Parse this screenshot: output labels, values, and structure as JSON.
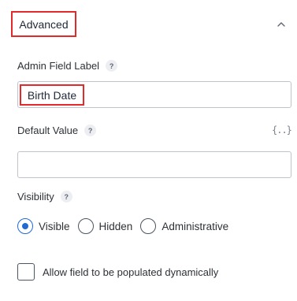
{
  "section": {
    "title": "Advanced",
    "collapse_icon": "chevron-up-icon"
  },
  "admin_label": {
    "label": "Admin Field Label",
    "help": "?",
    "value": "Birth Date"
  },
  "default_value": {
    "label": "Default Value",
    "help": "?",
    "value": "",
    "merge_tags_glyph": "{..}",
    "merge_tags_icon": "merge-tags-icon"
  },
  "visibility": {
    "label": "Visibility",
    "help": "?",
    "options": [
      "Visible",
      "Hidden",
      "Administrative"
    ],
    "selected": "Visible"
  },
  "dynamic_population": {
    "label": "Allow field to be populated dynamically",
    "checked": false
  },
  "colors": {
    "highlight_border": "#e22a2a",
    "radio_selected": "#1e6bd6"
  }
}
